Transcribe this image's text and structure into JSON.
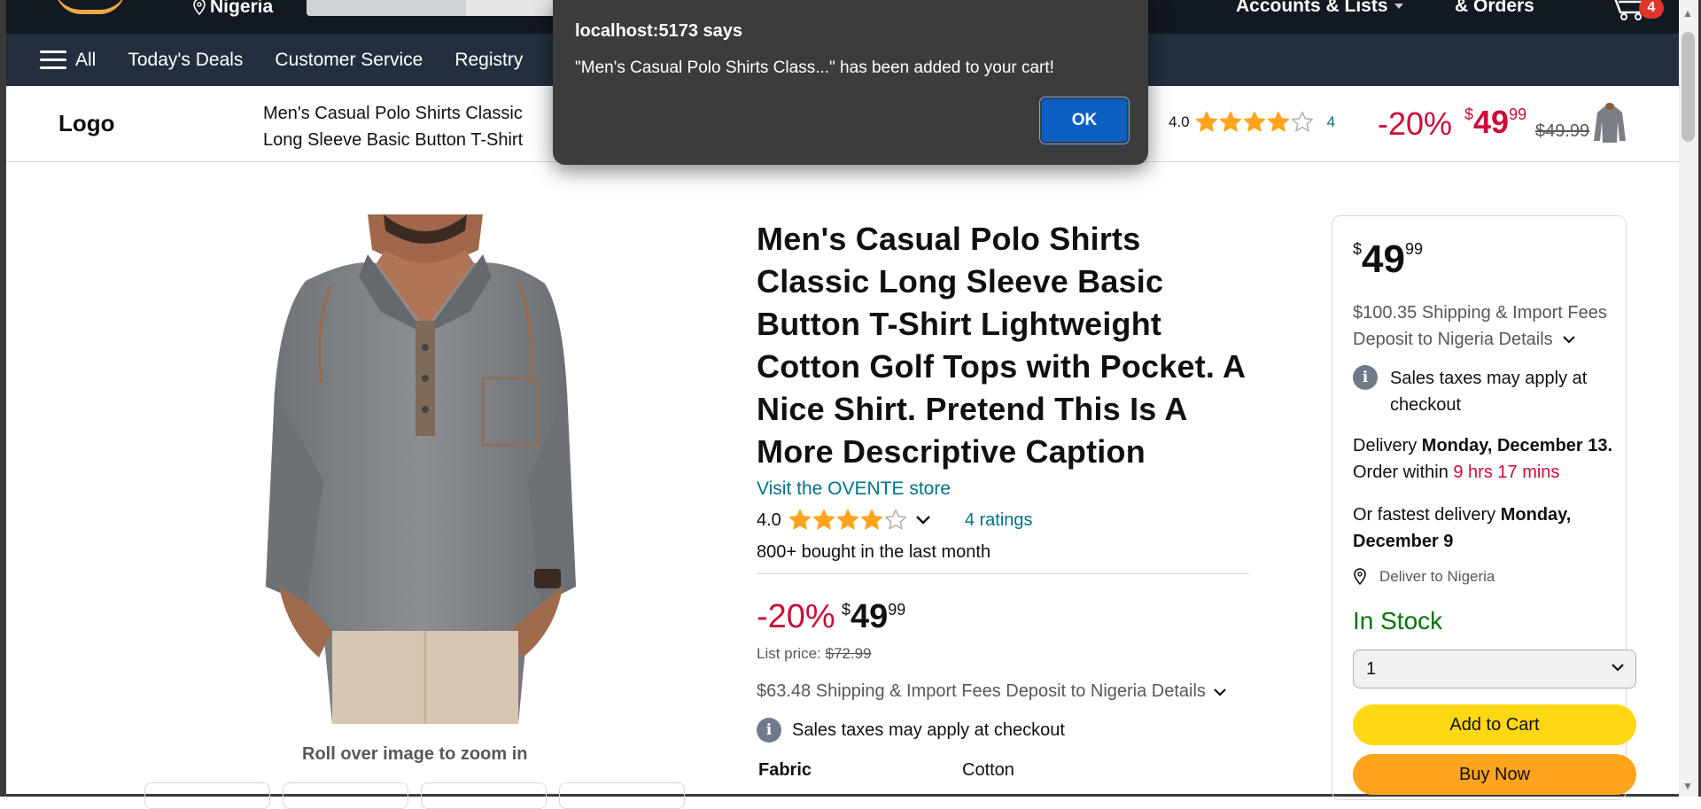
{
  "topnav": {
    "deliver_location": "Nigeria",
    "accounts_label": "Accounts & Lists",
    "orders_label": "& Orders",
    "cart_count": "4"
  },
  "subnav": {
    "all_label": "All",
    "items": [
      "Today's Deals",
      "Customer Service",
      "Registry"
    ]
  },
  "sticky": {
    "logo": "Logo",
    "title": "Men's Casual Polo Shirts Classic Long Sleeve Basic Button T-Shirt Lightweight Cotton Golf Tops with Pocket",
    "rating_value": "4.0",
    "rating_stars": 4,
    "rating_count": "4",
    "discount": "-20%",
    "price_currency": "$",
    "price_whole": "49",
    "price_fraction": "99",
    "old_price": "$49.99"
  },
  "product": {
    "title": "Men's Casual Polo Shirts Classic Long Sleeve Basic Button T-Shirt Lightweight Cotton Golf Tops with Pocket. A Nice Shirt. Pretend This Is A More Descriptive Caption",
    "store_link": "Visit the OVENTE store",
    "rating_value": "4.0",
    "rating_stars": 4,
    "ratings_count": "4 ratings",
    "bought": "800+ bought in the last month",
    "discount": "-20%",
    "price_currency": "$",
    "price_whole": "49",
    "price_fraction": "99",
    "list_price_label": "List price:",
    "list_price": "$72.99",
    "shipping": "$63.48 Shipping & Import Fees Deposit to Nigeria Details",
    "tax_note": "Sales taxes may apply at checkout",
    "spec_key": "Fabric",
    "spec_value": "Cotton",
    "zoom_hint": "Roll over image to zoom in"
  },
  "buybox": {
    "price_currency": "$",
    "price_whole": "49",
    "price_fraction": "99",
    "shipping_line1": "$100.35 Shipping & Import Fees",
    "shipping_line2": "Deposit to Nigeria Details",
    "tax_note": "Sales taxes may apply at checkout",
    "delivery_prefix": "Delivery ",
    "delivery_date": "Monday, December 13.",
    "order_within_prefix": "Order within ",
    "order_within_time": "9 hrs 17 mins",
    "fastest_prefix": "Or fastest delivery ",
    "fastest_date": "Monday, December 9",
    "deliver_to": "Deliver to Nigeria",
    "stock": "In Stock",
    "quantity": "1",
    "add_to_cart": "Add to Cart",
    "buy_now": "Buy Now"
  },
  "dialog": {
    "title": "localhost:5173 says",
    "message": "\"Men's Casual Polo Shirts Class...\" has been added to your cart!",
    "ok_label": "OK"
  },
  "colors": {
    "nav_dark": "#131921",
    "subnav": "#232f3e",
    "price_red": "#cc0c39",
    "link_teal": "#007185",
    "stock_green": "#007600",
    "cart_yellow": "#ffd814",
    "buy_orange": "#ffa41c",
    "star_gold": "#ffa41c",
    "dialog_bg": "#3c3c3c",
    "ok_blue": "#0b5fc0"
  }
}
